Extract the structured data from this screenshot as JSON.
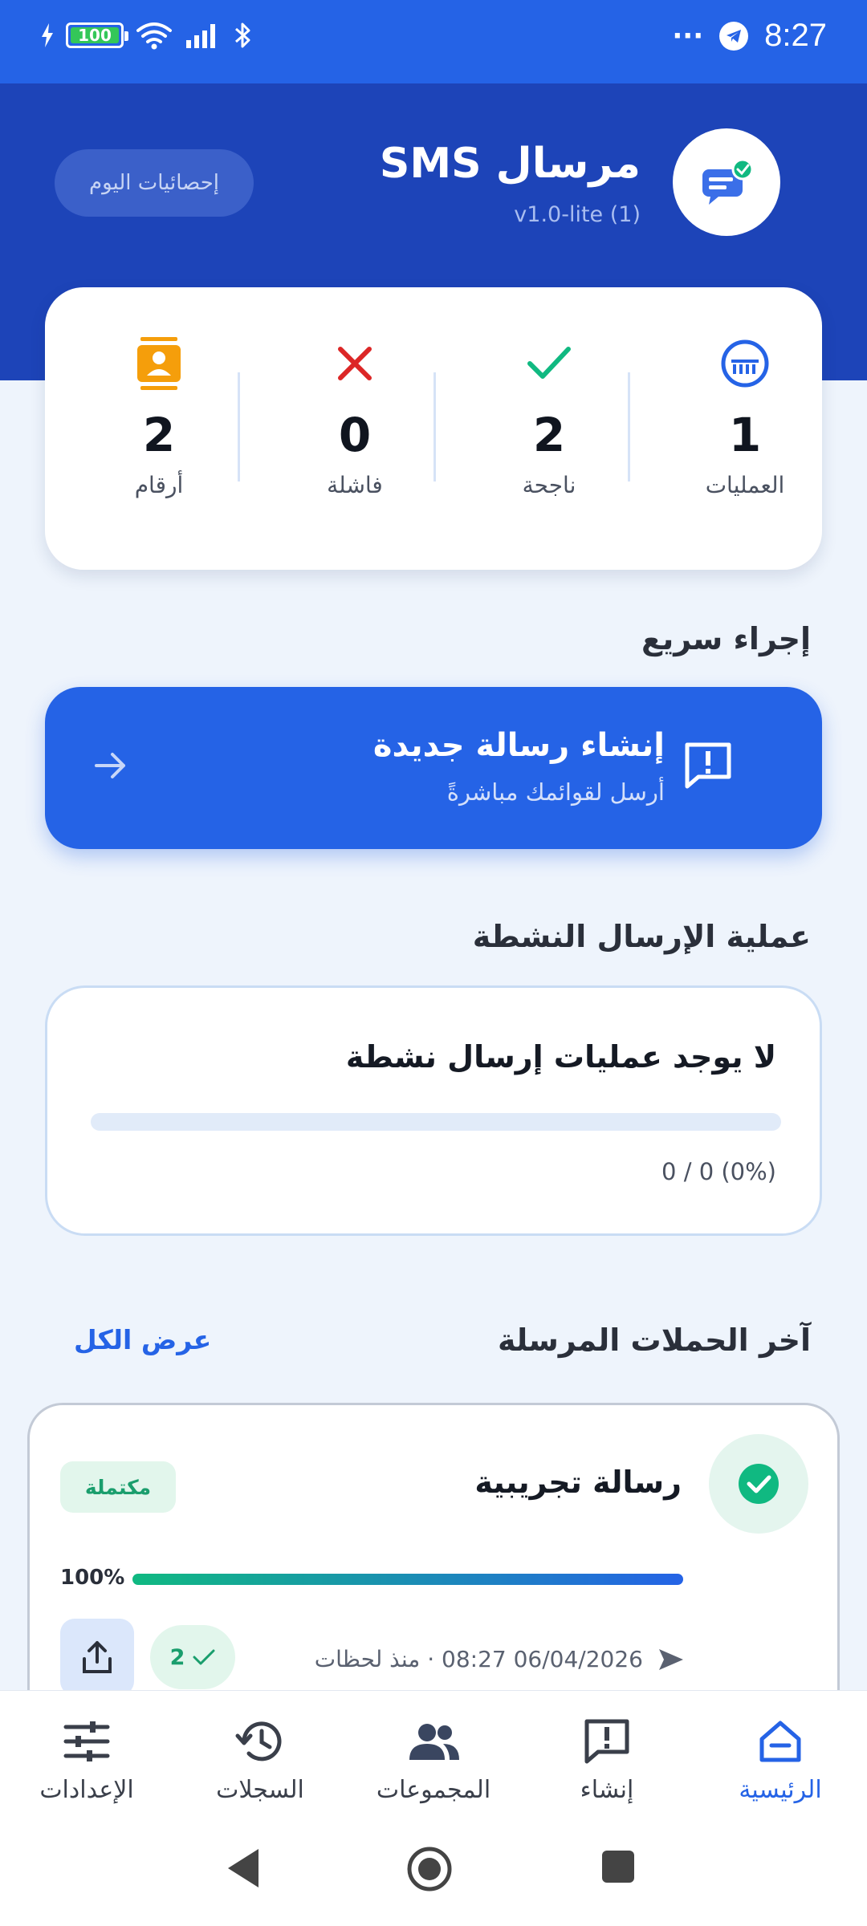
{
  "status_bar": {
    "battery": "100",
    "time": "8:27",
    "more": "···"
  },
  "header": {
    "title": "مرسال SMS",
    "version": "v1.0-lite (1)",
    "stats_button": "إحصائيات اليوم"
  },
  "stats": [
    {
      "icon": "operations-icon",
      "value": "1",
      "label": "العمليات",
      "color": "#2563e6"
    },
    {
      "icon": "check-icon",
      "value": "2",
      "label": "ناجحة",
      "color": "#10b981"
    },
    {
      "icon": "close-icon",
      "value": "0",
      "label": "فاشلة",
      "color": "#dc2626"
    },
    {
      "icon": "contact-icon",
      "value": "2",
      "label": "أرقام",
      "color": "#f59e0b"
    }
  ],
  "quick_action": {
    "section_title": "إجراء سريع",
    "title": "إنشاء رسالة جديدة",
    "subtitle": "أرسل لقوائمك مباشرةً"
  },
  "active_send": {
    "section_title": "عملية الإرسال النشطة",
    "status": "لا يوجد عمليات إرسال نشطة",
    "progress": 0,
    "count": "0 / 0 (0%)"
  },
  "recent": {
    "section_title": "آخر الحملات المرسلة",
    "view_all": "عرض الكل",
    "campaign": {
      "name": "رسالة تجريبية",
      "badge": "مكتملة",
      "percent_label": "100%",
      "progress": 1.0,
      "meta": "06/04/2026 08:27 · منذ لحظات",
      "sent": "2"
    }
  },
  "bottom_nav": [
    {
      "label": "الرئيسية",
      "icon": "home-icon",
      "active": true
    },
    {
      "label": "إنشاء",
      "icon": "compose-icon",
      "active": false
    },
    {
      "label": "المجموعات",
      "icon": "groups-icon",
      "active": false
    },
    {
      "label": "السجلات",
      "icon": "history-icon",
      "active": false
    },
    {
      "label": "الإعدادات",
      "icon": "settings-icon",
      "active": false
    }
  ],
  "colors": {
    "primary": "#2563e6",
    "header": "#1d44b8",
    "success": "#10b981",
    "danger": "#dc2626",
    "warning": "#f59e0b"
  }
}
